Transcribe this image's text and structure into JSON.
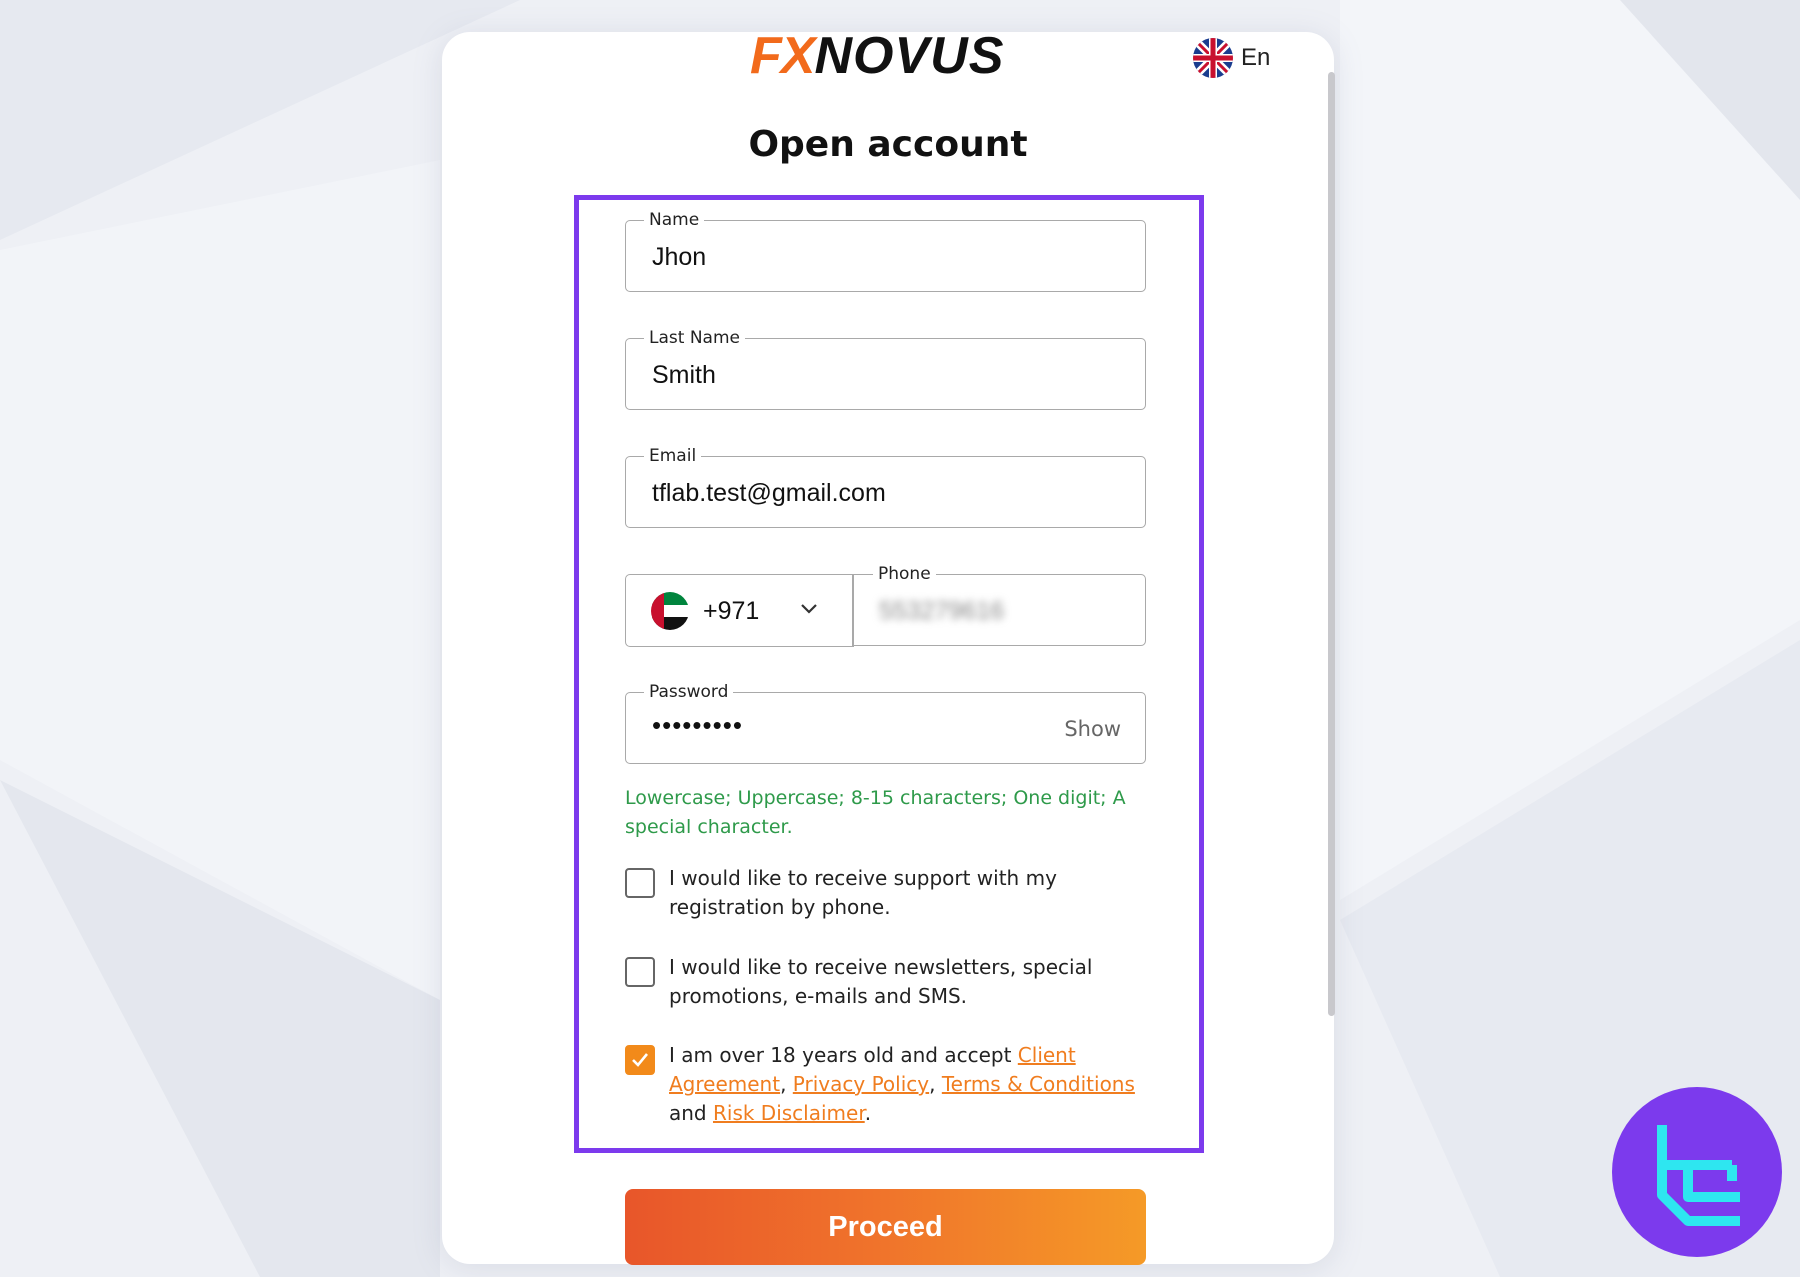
{
  "brand": {
    "logo_left": "FX",
    "logo_right": "NOVUS",
    "orange": "#f26a1b",
    "purple": "#7c3aed"
  },
  "language": {
    "label": "En",
    "icon": "uk-flag-icon"
  },
  "page": {
    "title": "Open account"
  },
  "form": {
    "name": {
      "label": "Name",
      "value": "Jhon"
    },
    "last_name": {
      "label": "Last Name",
      "value": "Smith"
    },
    "email": {
      "label": "Email",
      "value": "tflab.test@gmail.com"
    },
    "phone": {
      "country_code": "+971",
      "country_icon": "uae-flag-icon",
      "label": "Phone",
      "value": "553279616"
    },
    "password": {
      "label": "Password",
      "value": "•••••••••",
      "toggle_label": "Show"
    },
    "password_hint": "Lowercase; Uppercase; 8-15 characters; One digit; A special character.",
    "checks": [
      {
        "text": "I would like to receive support with my registration by phone.",
        "checked": false
      },
      {
        "text": "I would like to receive newsletters, special promotions, e-mails and SMS.",
        "checked": false
      },
      {
        "checked": true,
        "prefix": "I am over 18 years old and accept ",
        "link_client": "Client Agreement",
        "sep1": ", ",
        "link_privacy": "Privacy Policy",
        "sep2": ", ",
        "link_terms": "Terms & Conditions",
        "and": " and ",
        "link_risk": "Risk Disclaimer",
        "suffix": "."
      }
    ],
    "submit_label": "Proceed"
  }
}
